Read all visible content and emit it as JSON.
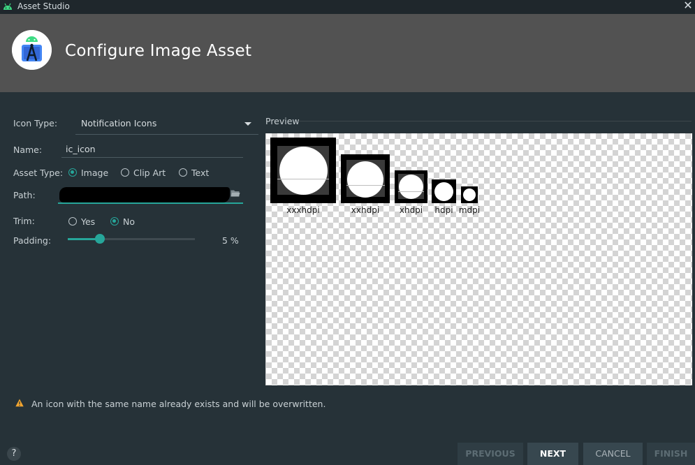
{
  "window": {
    "title": "Asset Studio",
    "close_glyph": "✕"
  },
  "header": {
    "title": "Configure Image Asset",
    "logo_icon": "android-studio-logo-icon"
  },
  "form": {
    "icon_type": {
      "label": "Icon Type:",
      "value": "Notification Icons"
    },
    "name": {
      "label": "Name:",
      "value": "ic_icon"
    },
    "asset_type": {
      "label": "Asset Type:",
      "options": [
        "Image",
        "Clip Art",
        "Text"
      ],
      "selected": "Image"
    },
    "path": {
      "label": "Path:",
      "value_redacted": true
    },
    "trim": {
      "label": "Trim:",
      "options": [
        "Yes",
        "No"
      ],
      "selected": "No"
    },
    "padding": {
      "label": "Padding:",
      "value": 5,
      "value_text": "5 %"
    }
  },
  "preview": {
    "title": "Preview",
    "densities": [
      "xxxhdpi",
      "xxhdpi",
      "xhdpi",
      "hdpi",
      "mdpi"
    ]
  },
  "warning": {
    "icon": "warning-triangle-icon",
    "text": "An icon with the same name already exists and will be overwritten."
  },
  "footer": {
    "help_glyph": "?",
    "buttons": {
      "previous": "PREVIOUS",
      "next": "NEXT",
      "cancel": "CANCEL",
      "finish": "FINISH"
    }
  },
  "colors": {
    "accent": "#26a69a",
    "background": "#263238",
    "header": "#525252",
    "warning": "#f2a52f"
  }
}
